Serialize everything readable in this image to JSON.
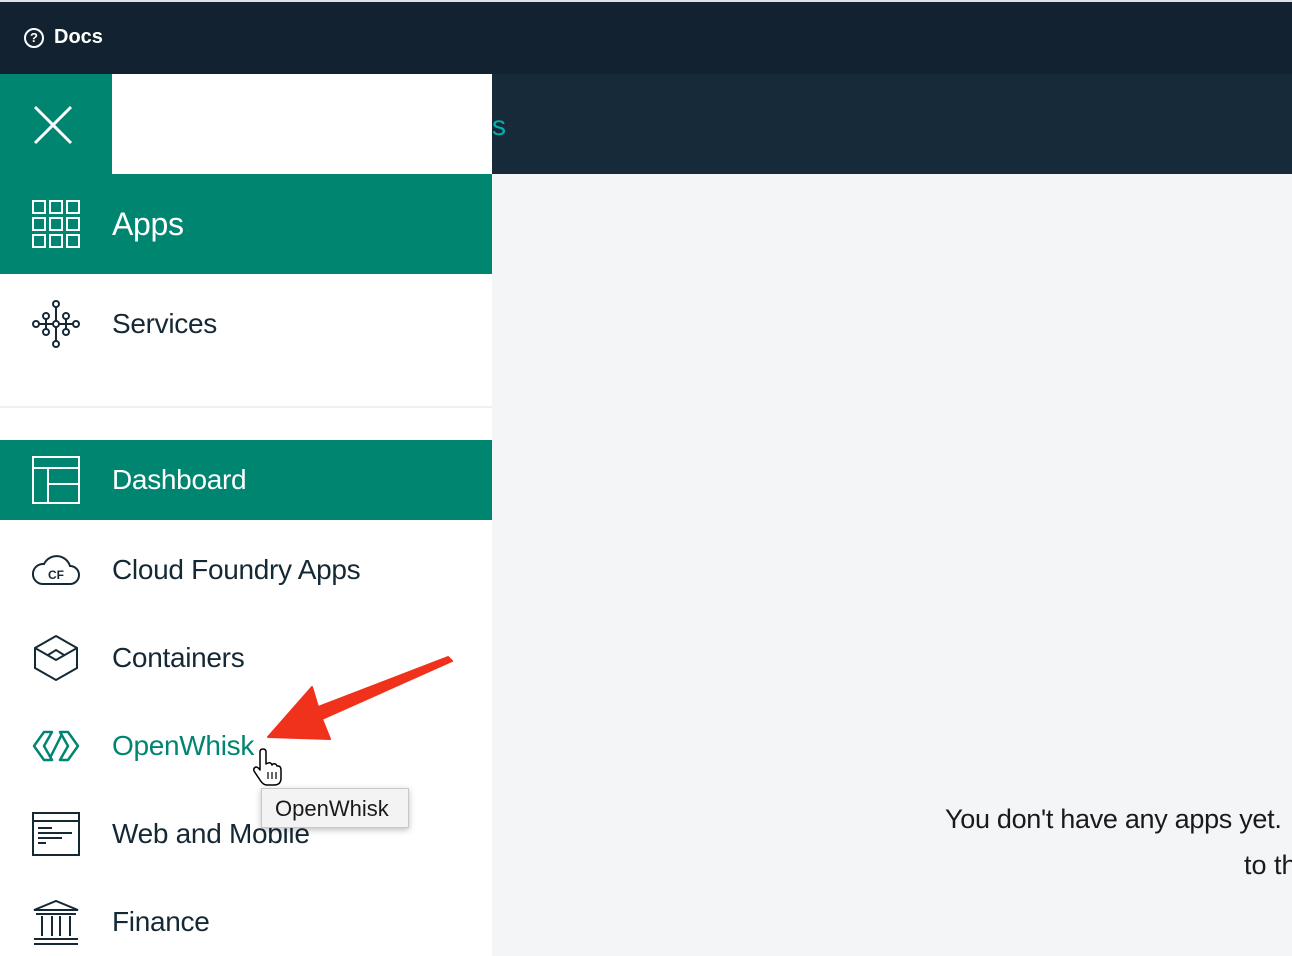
{
  "topbar": {
    "docs_label": "Docs",
    "docs_icon": "question-circle-icon"
  },
  "subbar": {
    "partial_text": "s"
  },
  "nav": {
    "primary": [
      {
        "label": "Apps",
        "icon": "grid-icon",
        "active": true
      },
      {
        "label": "Services",
        "icon": "services-network-icon",
        "active": false
      }
    ],
    "secondary": [
      {
        "label": "Dashboard",
        "icon": "dashboard-layout-icon",
        "active": true
      },
      {
        "label": "Cloud Foundry Apps",
        "icon": "cloud-cf-icon",
        "active": false
      },
      {
        "label": "Containers",
        "icon": "container-cube-icon",
        "active": false
      },
      {
        "label": "OpenWhisk",
        "icon": "openwhisk-icon",
        "active": false,
        "hovered": true
      },
      {
        "label": "Web and Mobile",
        "icon": "web-mobile-icon",
        "active": false
      },
      {
        "label": "Finance",
        "icon": "bank-icon",
        "active": false
      }
    ]
  },
  "tooltip": {
    "text": "OpenWhisk"
  },
  "main": {
    "empty_line_1": "You don't have any apps yet.",
    "empty_line_2": "to th"
  },
  "colors": {
    "accent": "#008571",
    "topbar": "#132231",
    "subbar": "#172a3a",
    "annotation_arrow": "#f0311c"
  }
}
